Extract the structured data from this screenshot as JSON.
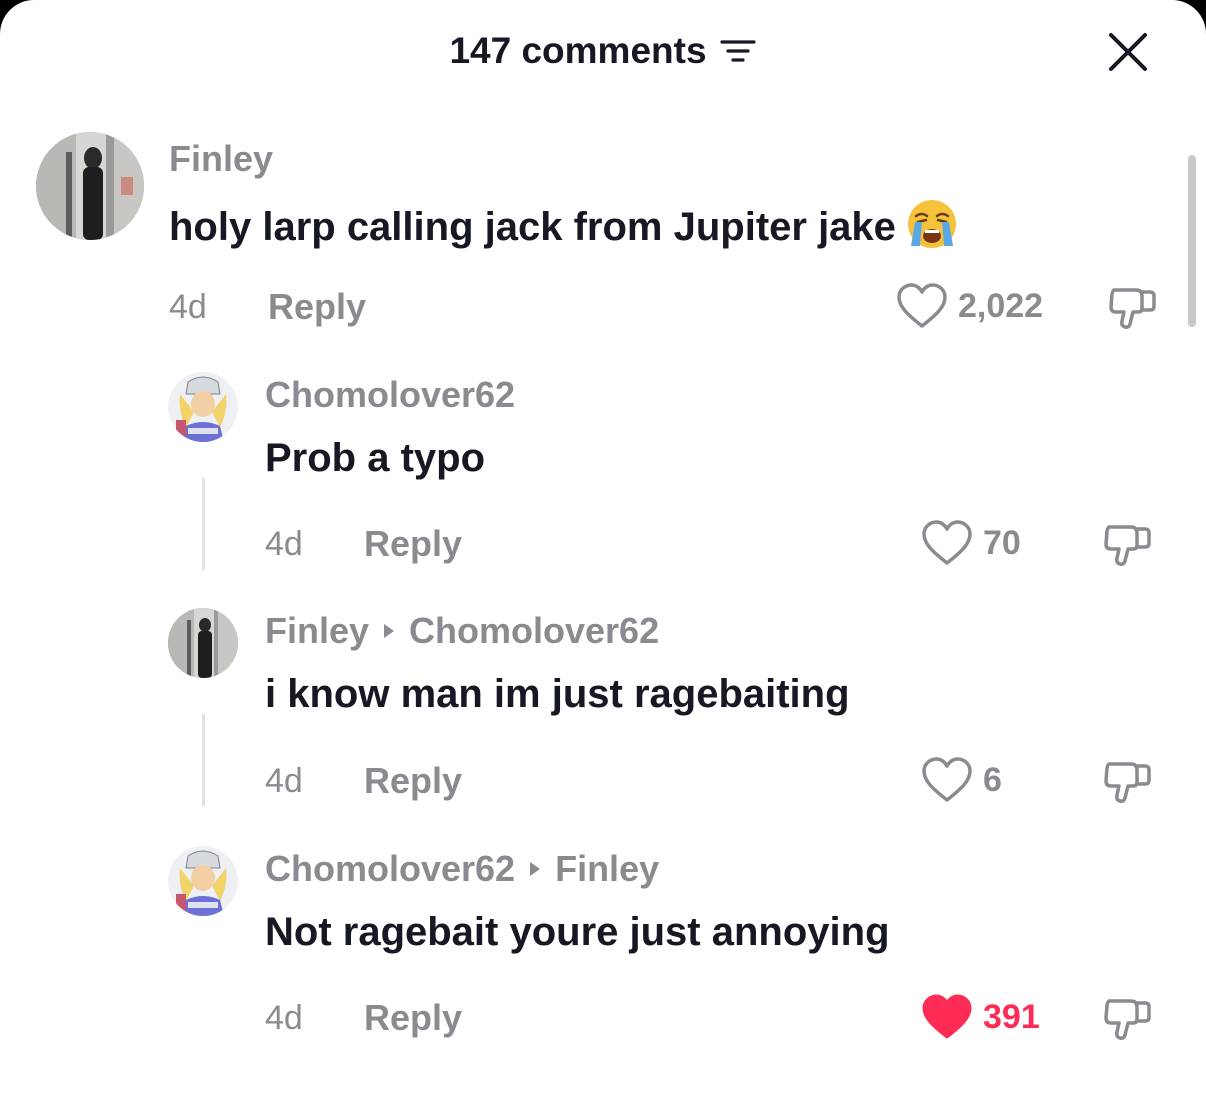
{
  "header": {
    "title": "147 comments",
    "filter_icon": "filter-lines-icon",
    "close_icon": "close-x-icon"
  },
  "colors": {
    "text_primary": "#161823",
    "text_secondary": "#8a8b91",
    "like_active": "#fe2c55"
  },
  "comments": [
    {
      "username": "Finley",
      "text": "holy larp calling jack from Jupiter jake",
      "emoji": "loudly-crying-face",
      "time": "4d",
      "reply_label": "Reply",
      "likes": "2,022",
      "liked": false
    },
    {
      "username": "Chomolover62",
      "text": "Prob a typo",
      "time": "4d",
      "reply_label": "Reply",
      "likes": "70",
      "liked": false
    },
    {
      "username": "Finley",
      "reply_to": "Chomolover62",
      "text": "i know man im just ragebaiting",
      "time": "4d",
      "reply_label": "Reply",
      "likes": "6",
      "liked": false
    },
    {
      "username": "Chomolover62",
      "reply_to": "Finley",
      "text": "Not ragebait youre just annoying",
      "time": "4d",
      "reply_label": "Reply",
      "likes": "391",
      "liked": true
    }
  ]
}
